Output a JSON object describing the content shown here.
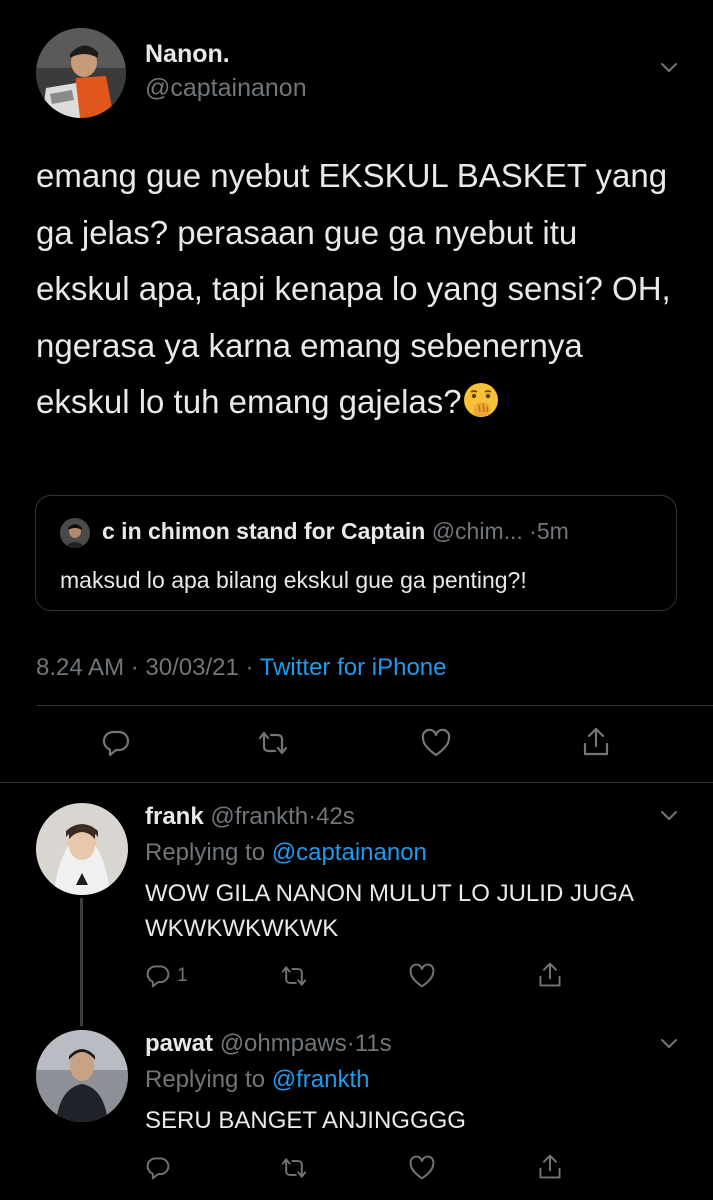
{
  "main_tweet": {
    "display_name": "Nanon.",
    "handle": "@captainanon",
    "text": "emang gue nyebut EKSKUL BASKET yang ga jelas? perasaan gue ga nyebut itu ekskul apa, tapi kenapa lo yang sensi? OH, ngerasa ya karna emang sebenernya ekskul lo tuh emang gajelas?",
    "emoji": "🤭",
    "quote": {
      "display_name": "c in chimon stand for Captain",
      "handle": "@chim...",
      "sep": "·",
      "time": "5m",
      "text": "maksud lo apa bilang ekskul gue ga penting?!"
    },
    "meta": {
      "time": "8.24 AM",
      "sep1": "·",
      "date": "30/03/21",
      "sep2": "·",
      "source": "Twitter for iPhone"
    },
    "actions": {
      "reply_icon": "reply-icon",
      "retweet_icon": "retweet-icon",
      "like_icon": "heart-icon",
      "share_icon": "share-icon"
    }
  },
  "replies": [
    {
      "display_name": "frank",
      "handle": "@frankth",
      "sep": "·",
      "time": "42s",
      "replying_prefix": "Replying to",
      "replying_to": "@captainanon",
      "text": "WOW GILA NANON MULUT LO JULID JUGA WKWKWKWKWK",
      "reply_count": "1"
    },
    {
      "display_name": "pawat",
      "handle": "@ohmpaws",
      "sep": "·",
      "time": "11s",
      "replying_prefix": "Replying to",
      "replying_to": "@frankth",
      "text": "SERU BANGET ANJINGGGG",
      "reply_count": ""
    }
  ],
  "colors": {
    "background": "#000000",
    "text": "#e7e9ea",
    "secondary": "#71767b",
    "link": "#1d9bf0",
    "border": "#2f3336"
  }
}
